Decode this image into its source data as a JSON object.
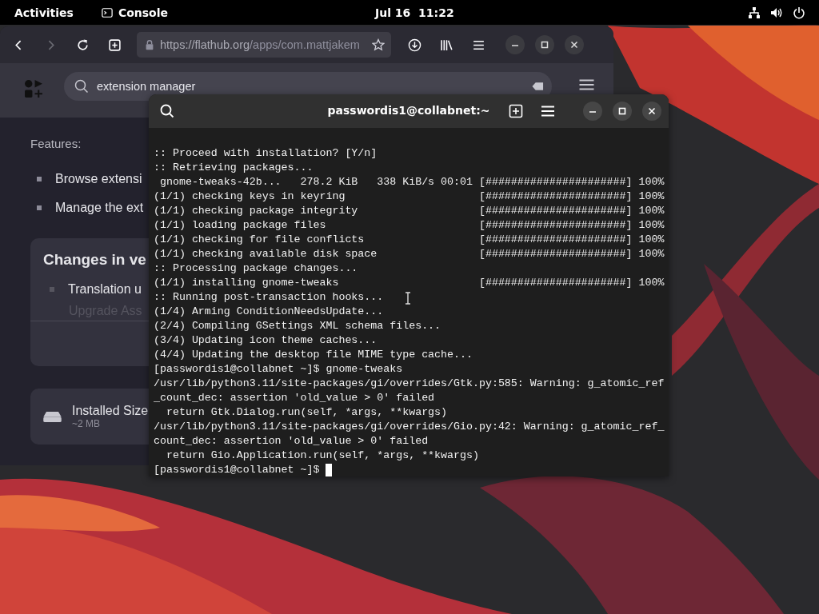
{
  "top_bar": {
    "activities": "Activities",
    "app": "Console",
    "clock": "Jul 16  11:22"
  },
  "browser": {
    "nav": [
      {
        "kind": "back",
        "disabled": false
      },
      {
        "kind": "forward",
        "disabled": true
      }
    ],
    "url_host": "https://flathub.org",
    "url_path": "/apps/com.mattjakem",
    "search": {
      "value": "extension manager"
    },
    "features_label": "Features:",
    "features": [
      "Browse extensi",
      "Manage the ext"
    ],
    "changes_card": {
      "title": "Changes in ve",
      "items": [
        "Translation u",
        "Upgrade Ass"
      ]
    },
    "installed": {
      "label": "Installed Size",
      "value": "~2 MB"
    }
  },
  "terminal": {
    "title": "passwordis1@collabnet:~",
    "lines": [
      ":: Proceed with installation? [Y/n]",
      ":: Retrieving packages...",
      " gnome-tweaks-42b...   278.2 KiB   338 KiB/s 00:01 [######################] 100%",
      "(1/1) checking keys in keyring                     [######################] 100%",
      "(1/1) checking package integrity                   [######################] 100%",
      "(1/1) loading package files                        [######################] 100%",
      "(1/1) checking for file conflicts                  [######################] 100%",
      "(1/1) checking available disk space                [######################] 100%",
      ":: Processing package changes...",
      "(1/1) installing gnome-tweaks                      [######################] 100%",
      ":: Running post-transaction hooks...",
      "(1/4) Arming ConditionNeedsUpdate...",
      "(2/4) Compiling GSettings XML schema files...",
      "(3/4) Updating icon theme caches...",
      "(4/4) Updating the desktop file MIME type cache...",
      "[passwordis1@collabnet ~]$ gnome-tweaks",
      "/usr/lib/python3.11/site-packages/gi/overrides/Gtk.py:585: Warning: g_atomic_ref",
      "_count_dec: assertion 'old_value > 0' failed",
      "  return Gtk.Dialog.run(self, *args, **kwargs)",
      "/usr/lib/python3.11/site-packages/gi/overrides/Gio.py:42: Warning: g_atomic_ref_",
      "count_dec: assertion 'old_value > 0' failed",
      "  return Gio.Application.run(self, *args, **kwargs)",
      "[passwordis1@collabnet ~]$ "
    ]
  }
}
